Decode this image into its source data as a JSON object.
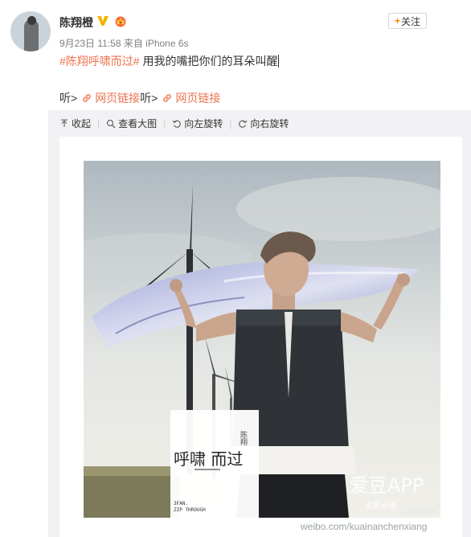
{
  "post": {
    "username": "陈翔橙",
    "follow_label": "关注",
    "follow_plus": "+",
    "meta": "9月23日 11:58 来自 iPhone 6s",
    "topic": "#陈翔呼啸而过#",
    "text": " 用我的嘴把你们的耳朵叫醒",
    "listen_label_1": "听>",
    "link_label_1": "网页链接",
    "listen_label_2": "听>",
    "link_label_2": "网页链接"
  },
  "toolbar": {
    "collapse": "收起",
    "view_large": "查看大图",
    "rotate_left": "向左旋转",
    "rotate_right": "向右旋转",
    "separator": "|"
  },
  "image": {
    "album_title": "呼啸  而过",
    "album_vertical_text": "陈翔",
    "album_subtitle_1": "3FAN.",
    "album_subtitle_2": "ZIP THROUGH",
    "app_watermark": "爱豆APP",
    "app_slogan": "追星必备",
    "weibo_watermark": "@陈翔米",
    "weibo_url": "weibo.com/kuainanchenxiang"
  },
  "colors": {
    "accent_orange": "#eb7350",
    "verified_gold": "#f5b400",
    "panel_bg": "#f2f2f5"
  },
  "icons": {
    "verified": "verified-v-icon",
    "member": "member-crown-icon",
    "link": "link-chain-icon",
    "collapse": "arrow-up-icon",
    "zoom": "magnifier-icon",
    "rotate_left": "rotate-left-icon",
    "rotate_right": "rotate-right-icon"
  }
}
